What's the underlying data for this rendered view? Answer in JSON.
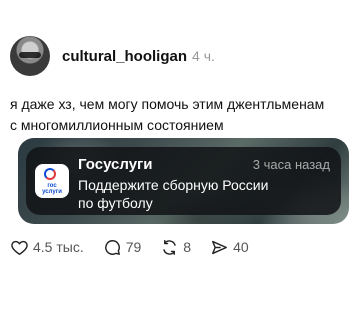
{
  "post": {
    "author": "cultural_hooligan",
    "time": "4 ч.",
    "text": "я даже хз, чем могу помочь этим джентльменам\nс многомиллионным состоянием"
  },
  "notification": {
    "app_icon_label": "гос\nуслуги",
    "app_name": "Госуслуги",
    "time": "3 часа назад",
    "body": "Поддержите сборную России\nпо футболу"
  },
  "actions": {
    "likes": "4.5 тыс.",
    "comments": "79",
    "reposts": "8",
    "shares": "40"
  },
  "colors": {
    "brand_blue": "#0d4cd3",
    "brand_red": "#e0393e"
  }
}
